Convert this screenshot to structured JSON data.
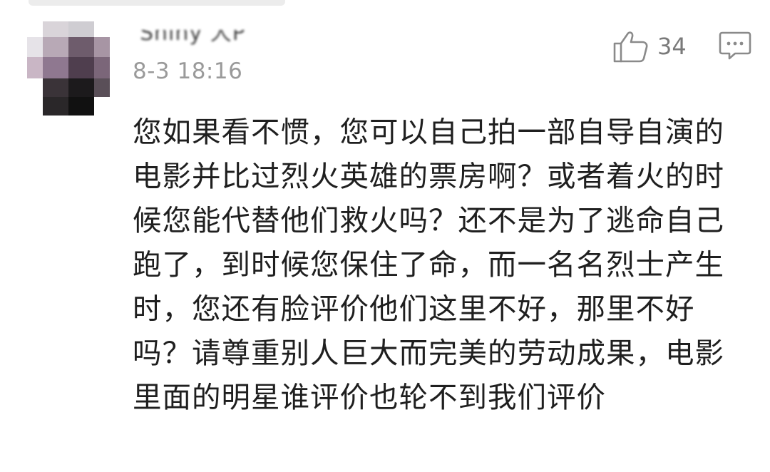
{
  "comment": {
    "username": "Shiny 大P",
    "timestamp": "8-3 18:16",
    "likes": "34",
    "text": "您如果看不惯，您可以自己拍一部自导自演的电影并比过烈火英雄的票房啊？或者着火的时候您能代替他们救火吗？还不是为了逃命自己跑了，到时候您保住了命，而一名名烈士产生时，您还有脸评价他们这里不好，那里不好吗？请尊重别人巨大而完美的劳动成果，电影里面的明星谁评价也轮不到我们评价"
  },
  "icons": {
    "like": "thumbs-up-icon",
    "reply": "comment-bubble-icon",
    "avatar": "pixelated-avatar"
  },
  "colors": {
    "text": "#1f1f1f",
    "meta": "#9a9a9a",
    "icon": "#8a8a8a"
  }
}
